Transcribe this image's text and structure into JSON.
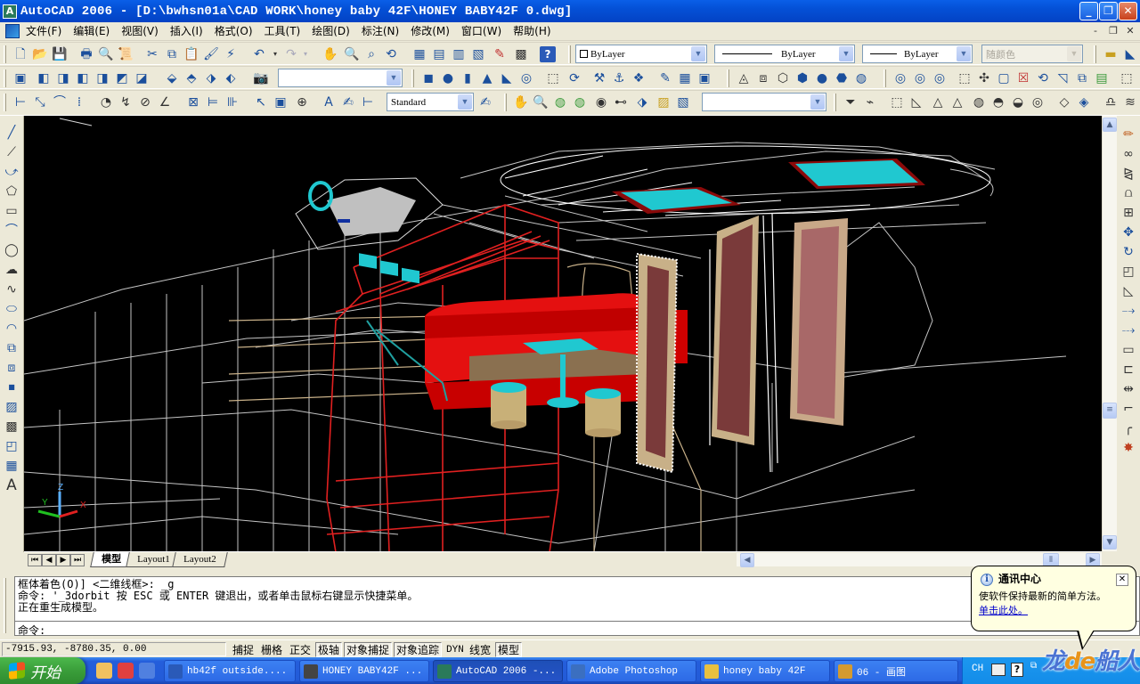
{
  "window": {
    "app_icon": "autocad-icon",
    "title": "AutoCAD 2006 - [D:\\bwhsn01a\\CAD WORK\\honey baby 42F\\HONEY BABY42F 0.dwg]",
    "controls": {
      "minimize": "_",
      "restore": "❐",
      "close": "✕"
    }
  },
  "menubar": {
    "items": [
      {
        "label": "文件(F)"
      },
      {
        "label": "编辑(E)"
      },
      {
        "label": "视图(V)"
      },
      {
        "label": "插入(I)"
      },
      {
        "label": "格式(O)"
      },
      {
        "label": "工具(T)"
      },
      {
        "label": "绘图(D)"
      },
      {
        "label": "标注(N)"
      },
      {
        "label": "修改(M)"
      },
      {
        "label": "窗口(W)"
      },
      {
        "label": "帮助(H)"
      }
    ],
    "doc_controls": {
      "minimize": "-",
      "restore": "❐",
      "close": "✕"
    }
  },
  "toolbars": {
    "standard_icons": [
      "new-icon",
      "open-icon",
      "save-icon",
      "print-icon",
      "print-preview-icon",
      "publish-icon",
      "cut-icon",
      "copy-icon",
      "paste-icon",
      "match-properties-icon",
      "block-editor-icon",
      "undo-icon",
      "redo-icon",
      "pan-icon",
      "zoom-realtime-icon",
      "zoom-window-icon",
      "zoom-previous-icon",
      "properties-icon",
      "design-center-icon",
      "tool-palettes-icon",
      "sheet-set-icon",
      "markup-icon",
      "calculator-icon",
      "help-icon"
    ],
    "properties": {
      "color": "ByLayer",
      "linetype": "ByLayer",
      "lineweight": "ByLayer",
      "plotstyle": "随颜色"
    },
    "view_combo": "",
    "text_style": "Standard",
    "ucs_combo": ""
  },
  "left_toolbar": [
    "line-icon",
    "construction-line-icon",
    "polyline-icon",
    "polygon-icon",
    "rectangle-icon",
    "arc-icon",
    "circle-icon",
    "revision-cloud-icon",
    "spline-icon",
    "ellipse-icon",
    "ellipse-arc-icon",
    "insert-block-icon",
    "make-block-icon",
    "point-icon",
    "hatch-icon",
    "gradient-icon",
    "region-icon",
    "table-icon",
    "multiline-text-icon"
  ],
  "right_toolbar": [
    "erase-icon",
    "copy-object-icon",
    "mirror-icon",
    "offset-icon",
    "array-icon",
    "move-icon",
    "rotate-icon",
    "scale-icon",
    "stretch-icon",
    "trim-icon",
    "extend-icon",
    "break-at-point-icon",
    "break-icon",
    "join-icon",
    "chamfer-icon",
    "fillet-icon",
    "explode-icon"
  ],
  "viewport": {
    "background": "#000000",
    "ucs": {
      "x": "X",
      "y": "Y",
      "z": "Z"
    }
  },
  "layout_tabs": [
    {
      "label": "模型",
      "active": true
    },
    {
      "label": "Layout1",
      "active": false
    },
    {
      "label": "Layout2",
      "active": false
    }
  ],
  "command": {
    "history": [
      "框体着色(O)] <二维线框>: _g",
      "命令: '_3dorbit 按 ESC 或 ENTER 键退出，或者单击鼠标右键显示快捷菜单。",
      "正在重生成模型。"
    ],
    "prompt": "命令:"
  },
  "statusbar": {
    "coordinates": "-7915.93, -8780.35, 0.00",
    "toggles": [
      {
        "label": "捕捉",
        "on": false
      },
      {
        "label": "栅格",
        "on": false
      },
      {
        "label": "正交",
        "on": false
      },
      {
        "label": "极轴",
        "on": true
      },
      {
        "label": "对象捕捉",
        "on": true
      },
      {
        "label": "对象追踪",
        "on": true
      },
      {
        "label": "DYN",
        "on": false
      },
      {
        "label": "线宽",
        "on": false
      },
      {
        "label": "模型",
        "on": true
      }
    ]
  },
  "balloon": {
    "title": "通讯中心",
    "message": "使软件保持最新的简单方法。",
    "link": "单击此处。",
    "close": "✕"
  },
  "taskbar": {
    "start": "开始",
    "tasks": [
      {
        "label": "hb42f outside....",
        "active": false,
        "icon_color": "#2a5ab8"
      },
      {
        "label": "HONEY BABY42F ...",
        "active": false,
        "icon_color": "#444"
      },
      {
        "label": "AutoCAD 2006 -...",
        "active": true,
        "icon_color": "#2a7a5a"
      },
      {
        "label": "Adobe Photoshop",
        "active": false,
        "icon_color": "#3b6fc0"
      },
      {
        "label": "honey baby 42F",
        "active": false,
        "icon_color": "#e8c040"
      },
      {
        "label": "06 - 画图",
        "active": false,
        "icon_color": "#d49a30"
      }
    ],
    "tray": {
      "lang": "CH"
    },
    "watermark": {
      "a": "龙",
      "b": "de",
      "c": "船人"
    }
  }
}
